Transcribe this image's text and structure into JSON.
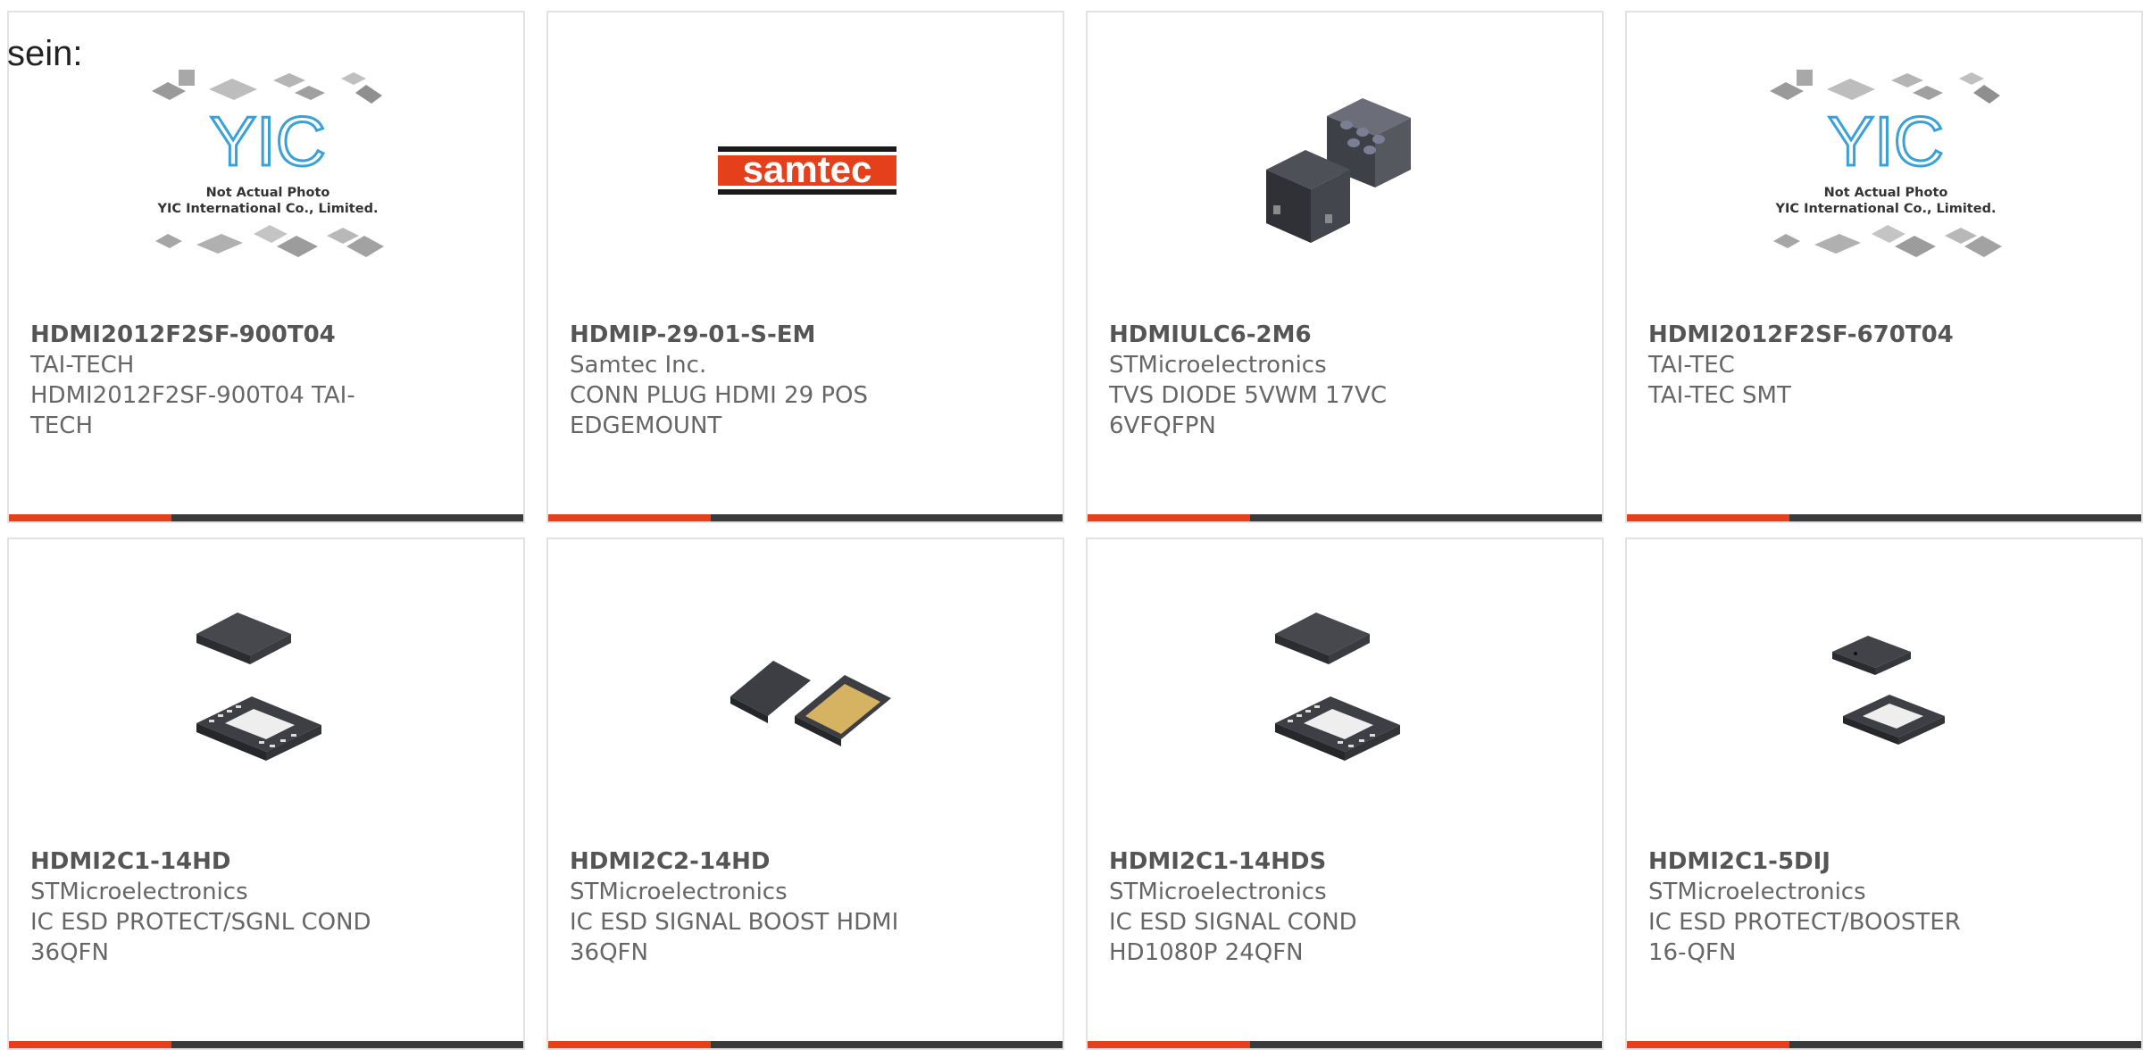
{
  "intro_text": "sein:",
  "products": [
    {
      "part": "HDMI2012F2SF-900T04",
      "manufacturer": "TAI-TECH",
      "description": "HDMI2012F2SF-900T04 TAI-TECH",
      "image": "placeholder-photo-icon",
      "placeholder_line1": "Not Actual Photo",
      "placeholder_line2": "YIC International Co., Limited."
    },
    {
      "part": "HDMIP-29-01-S-EM",
      "manufacturer": "Samtec Inc.",
      "description": "CONN PLUG HDMI 29 POS EDGEMOUNT",
      "image": "samtec-logo",
      "logo_text": "samtec"
    },
    {
      "part": "HDMIULC6-2M6",
      "manufacturer": "STMicroelectronics",
      "description": "TVS DIODE 5VWM 17VC 6VFQFPN",
      "image": "dfn-package-icon"
    },
    {
      "part": "HDMI2012F2SF-670T04",
      "manufacturer": "TAI-TEC",
      "description": "TAI-TEC SMT",
      "image": "placeholder-photo-icon",
      "placeholder_line1": "Not Actual Photo",
      "placeholder_line2": "YIC International Co., Limited."
    },
    {
      "part": "HDMI2C1-14HD",
      "manufacturer": "STMicroelectronics",
      "description": "IC ESD PROTECT/SGNL COND 36QFN",
      "image": "qfn-package-icon"
    },
    {
      "part": "HDMI2C2-14HD",
      "manufacturer": "STMicroelectronics",
      "description": "IC ESD SIGNAL BOOST HDMI 36QFN",
      "image": "gold-qfn-package-icon"
    },
    {
      "part": "HDMI2C1-14HDS",
      "manufacturer": "STMicroelectronics",
      "description": "IC ESD SIGNAL COND HD1080P 24QFN",
      "image": "qfn-package-icon"
    },
    {
      "part": "HDMI2C1-5DIJ",
      "manufacturer": "STMicroelectronics",
      "description": "IC ESD PROTECT/BOOSTER 16-QFN",
      "image": "qfn-small-package-icon"
    }
  ],
  "colors": {
    "accent": "#e5401c",
    "bar": "#3a3a3a",
    "border": "#e2e2e2",
    "text": "#555555"
  }
}
